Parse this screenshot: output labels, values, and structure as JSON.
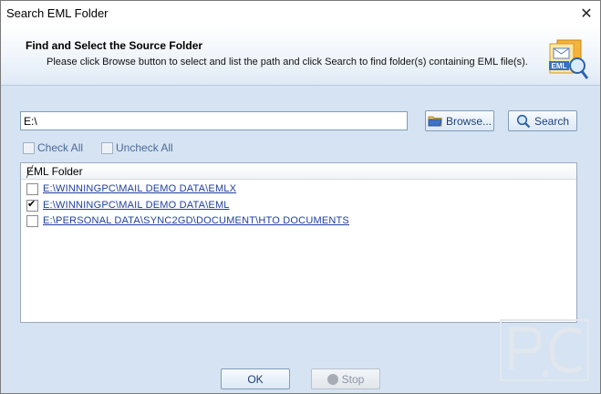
{
  "window": {
    "title": "Search EML Folder",
    "close_glyph": "✕"
  },
  "header": {
    "title": "Find and Select the Source Folder",
    "subtitle": "Please click Browse button to select and list the path and click Search to find folder(s) containing EML file(s).",
    "icon": "eml-search-icon",
    "icon_label": "EML"
  },
  "path": {
    "value": "E:\\"
  },
  "buttons": {
    "browse": "Browse...",
    "search": "Search",
    "ok": "OK",
    "stop": "Stop"
  },
  "checks": {
    "check_all": "Check All",
    "uncheck_all": "Uncheck All"
  },
  "grid": {
    "column": "EML Folder",
    "rows": [
      {
        "path": "E:\\WINNINGPC\\MAIL DEMO DATA\\EMLX",
        "checked": false
      },
      {
        "path": "E:\\WINNINGPC\\MAIL DEMO DATA\\EML",
        "checked": true
      },
      {
        "path": "E:\\PERSONAL DATA\\SYNC2GD\\DOCUMENT\\HTO DOCUMENTS",
        "checked": false
      }
    ]
  },
  "colors": {
    "accent": "#1f3f9f",
    "panel": "#d6e3f2",
    "header_border": "#b7c9df"
  }
}
